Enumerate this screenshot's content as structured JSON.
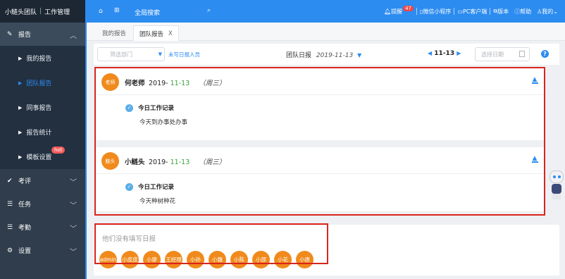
{
  "brand": {
    "team": "小鲢头团队",
    "mode": "工作管理"
  },
  "sidebar": {
    "sections": [
      {
        "label": "报告",
        "icon": "edit-icon"
      },
      {
        "label": "考评",
        "icon": "check-icon"
      },
      {
        "label": "任务",
        "icon": "list-icon"
      },
      {
        "label": "考勤",
        "icon": "list-icon"
      },
      {
        "label": "设置",
        "icon": "gear-icon"
      }
    ],
    "report_items": [
      {
        "label": "我的报告"
      },
      {
        "label": "团队报告"
      },
      {
        "label": "同事报告"
      },
      {
        "label": "报告统计"
      },
      {
        "label": "模板设置",
        "badge": "hot"
      }
    ]
  },
  "topbar": {
    "search_label": "全局搜索",
    "reminder_label": "提醒",
    "reminder_count": "47",
    "wechat_label": "微信小程序",
    "pc_label": "PC客户端",
    "version_label": "版本",
    "help_label": "帮助",
    "me_label": "我的"
  },
  "tabs": [
    {
      "label": "我的报告"
    },
    {
      "label": "团队报告",
      "close": "X"
    }
  ],
  "filter": {
    "dept_placeholder": "筛选部门",
    "unfilled_link": "未写日报人员",
    "title": "团队日报",
    "date": "2019-11-13",
    "range": "11-13",
    "pick_date_placeholder": "选择日期",
    "help": "?"
  },
  "reports": [
    {
      "avatar": "老师",
      "name": "何老师",
      "year": "2019-",
      "md": "11-13",
      "weekday": "（周三）",
      "entry_title": "今日工作记录",
      "entry_text": "今天到办事处办事"
    },
    {
      "avatar": "鲢头",
      "name": "小鲢头",
      "year": "2019-",
      "md": "11-13",
      "weekday": "（周三）",
      "entry_title": "今日工作记录",
      "entry_text": "今天种树种花"
    }
  ],
  "not_filled": {
    "title": "他们没有填写日报",
    "people": [
      "admin",
      "小皮皮",
      "小廖",
      "王经理",
      "小孙",
      "小魏",
      "小陈",
      "小邵",
      "小花",
      "小唐"
    ]
  },
  "colors": {
    "primary": "#2d8cf0",
    "sidebar": "#2f3d4c",
    "avatar": "#f08a1c",
    "highlight": "#d9251c"
  }
}
